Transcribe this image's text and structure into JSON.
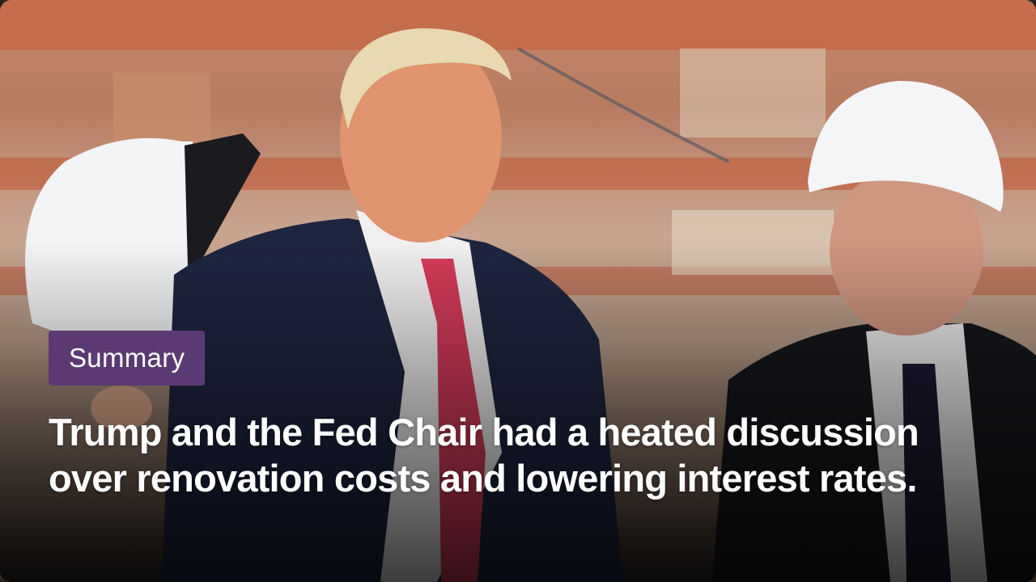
{
  "card": {
    "badge_label": "Summary",
    "headline": "Trump and the Fed Chair had a heated discussion over renovation costs and lowering interest rates."
  },
  "colors": {
    "badge_background": "#5b3a73",
    "headline_text": "#ffffff"
  }
}
